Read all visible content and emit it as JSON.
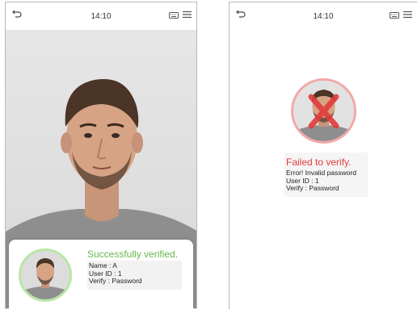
{
  "left_screen": {
    "status_bar": {
      "time": "14:10",
      "icons": [
        "back-arrow-icon",
        "keyboard-icon",
        "menu-icon"
      ]
    },
    "result": {
      "title": "Successfully verified.",
      "name_line": "Name : A",
      "user_id_line": "User ID : 1",
      "verify_line": "Verify : Password"
    }
  },
  "right_screen": {
    "status_bar": {
      "time": "14:10",
      "icons": [
        "back-arrow-icon",
        "keyboard-icon",
        "menu-icon"
      ]
    },
    "result": {
      "title": "Failed to verify.",
      "error_line": "Error! Invalid password",
      "user_id_line": "User ID : 1",
      "verify_line": "Verify : Password"
    }
  },
  "colors": {
    "success": "#67b84a",
    "success_ring": "#b9e6a6",
    "failure": "#e33c3c",
    "failure_ring": "#f2a7a7"
  }
}
